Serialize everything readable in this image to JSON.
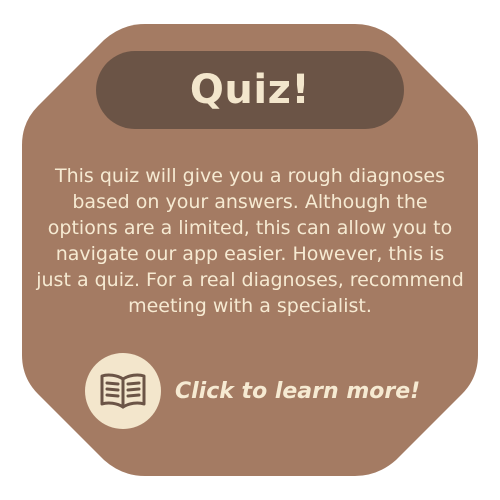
{
  "card": {
    "title": "Quiz!",
    "description": "This quiz will give you a rough diagnoses based on your answers. Although the options are a limited, this can allow you to navigate our app easier. However, this is just a quiz. For a real diagnoses, recommend meeting with a specialist.",
    "cta_label": "Click to learn more!",
    "cta_icon": "book-icon"
  },
  "colors": {
    "background": "#ffffff",
    "card": "#a47b63",
    "title_pill": "#6b5446",
    "text": "#f6ead2",
    "icon_circle": "#f3e6cc",
    "icon_stroke": "#6b5446"
  }
}
